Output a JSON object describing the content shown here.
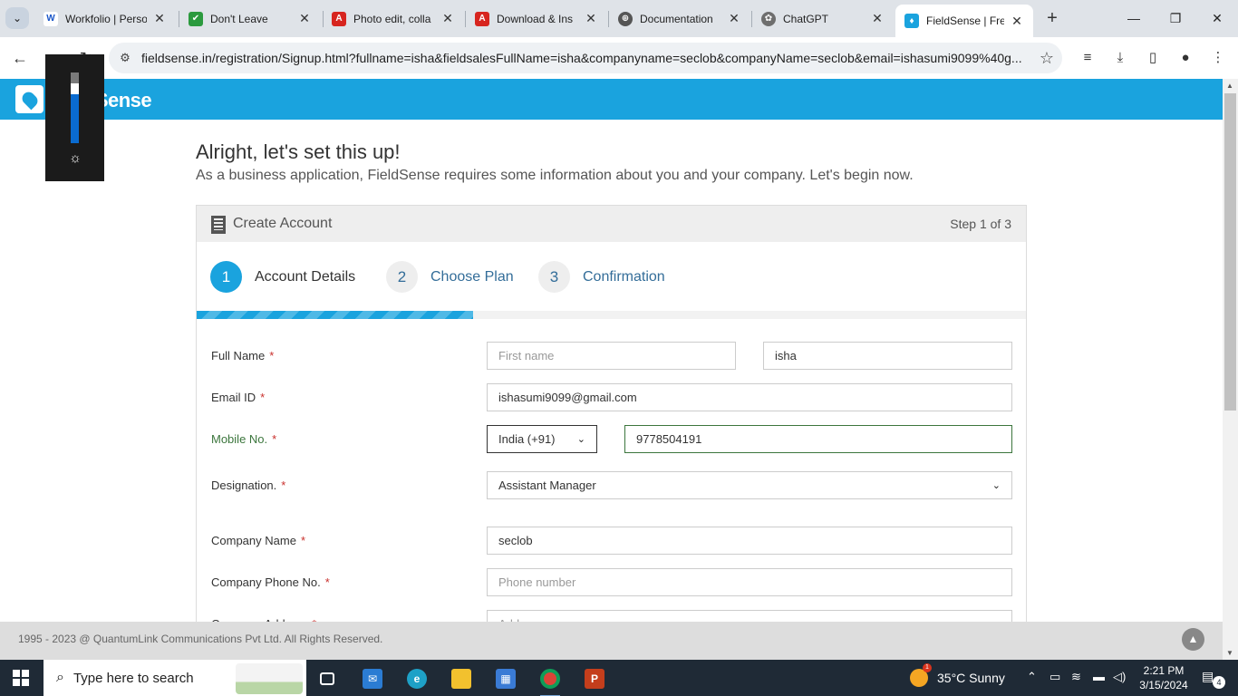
{
  "browser": {
    "tabs": [
      {
        "title": "Workfolio | Perso",
        "favicon": "W",
        "favicon_color": "#1a56c8",
        "active": false
      },
      {
        "title": "Don't Leave",
        "favicon": "✔",
        "favicon_color": "#2b9a3e",
        "active": false
      },
      {
        "title": "Photo edit, colla",
        "favicon": "A",
        "favicon_color": "#d7251f",
        "active": false
      },
      {
        "title": "Download & Ins",
        "favicon": "A",
        "favicon_color": "#d7251f",
        "active": false
      },
      {
        "title": "Documentation",
        "favicon": "⊕",
        "favicon_color": "#555555",
        "active": false
      },
      {
        "title": "ChatGPT",
        "favicon": "✿",
        "favicon_color": "#6e6e6e",
        "active": false
      },
      {
        "title": "FieldSense | Free",
        "favicon": "♦",
        "favicon_color": "#1aa3de",
        "active": true
      }
    ],
    "url": "fieldsense.in/registration/Signup.html?fullname=isha&fieldsalesFullName=isha&companyname=seclob&companyName=seclob&email=ishasumi9099%40g..."
  },
  "brand": {
    "name": "FieldSense",
    "color": "#1aa3de"
  },
  "page": {
    "heading": "Alright, let's set this up!",
    "subheading": "As a business application, FieldSense requires some information about you and your company. Let's begin now."
  },
  "panel": {
    "title": "Create Account",
    "step_text": "Step 1 of 3",
    "steps": [
      {
        "num": "1",
        "label": "Account Details",
        "active": true
      },
      {
        "num": "2",
        "label": "Choose Plan",
        "active": false
      },
      {
        "num": "3",
        "label": "Confirmation",
        "active": false
      }
    ],
    "progress_fraction": 0.333
  },
  "form": {
    "full_name": {
      "label": "Full Name",
      "first_placeholder": "First name",
      "last_value": "isha"
    },
    "email": {
      "label": "Email ID",
      "value": "ishasumi9099@gmail.com"
    },
    "mobile": {
      "label": "Mobile No.",
      "country": "India (+91)",
      "value": "9778504191"
    },
    "designation": {
      "label": "Designation.",
      "value": "Assistant Manager"
    },
    "company_name": {
      "label": "Company Name",
      "value": "seclob"
    },
    "company_phone": {
      "label": "Company Phone No.",
      "placeholder": "Phone number"
    },
    "company_address": {
      "label": "Company Address",
      "placeholder": "Address"
    },
    "required_mark": "*"
  },
  "footer": {
    "copyright": "1995 - 2023 @ QuantumLink Communications Pvt Ltd. All Rights Reserved."
  },
  "taskbar": {
    "search_text": "Type here to search",
    "weather": "35°C  Sunny",
    "weather_badge": "1",
    "time": "2:21 PM",
    "date": "3/15/2024",
    "notifications": "4"
  }
}
